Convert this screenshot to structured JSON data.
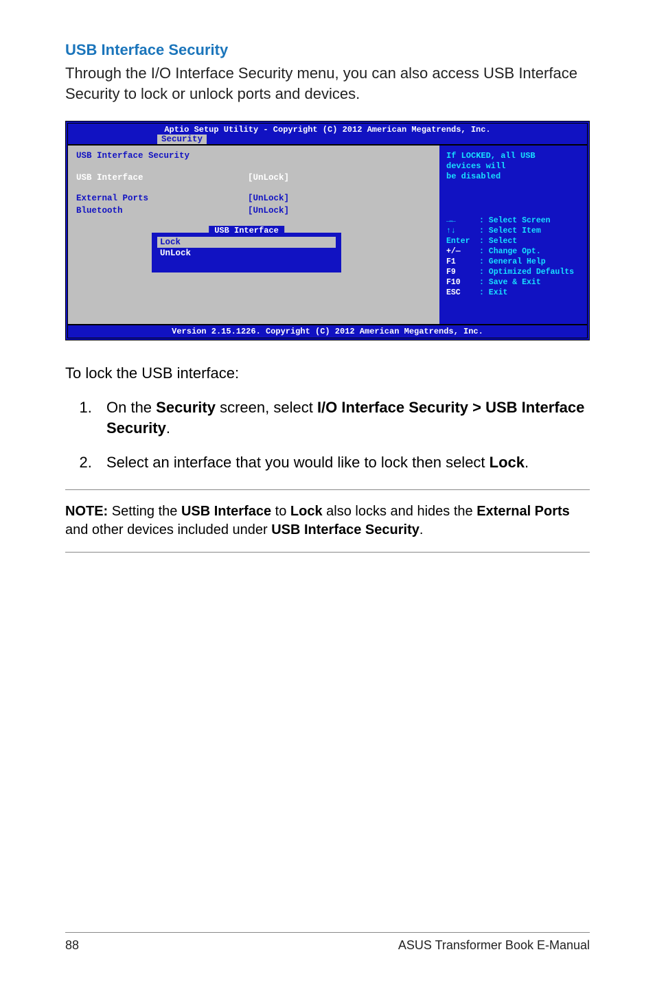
{
  "heading": "USB Interface Security",
  "body_text": "Through the I/O Interface Security menu, you can also access USB Interface Security to lock or unlock ports and devices.",
  "bios": {
    "header": "Aptio Setup Utility - Copyright (C) 2012 American Megatrends, Inc.",
    "tab": "Security",
    "left_title": "USB Interface Security",
    "rows": [
      {
        "label": "USB Interface",
        "value": "[UnLock]",
        "selected": true
      },
      {
        "label": "External Ports",
        "value": "[UnLock]",
        "selected": false
      },
      {
        "label": "Bluetooth",
        "value": "[UnLock]",
        "selected": false
      }
    ],
    "popup": {
      "title": "USB Interface",
      "items": [
        {
          "text": "Lock",
          "selected": true
        },
        {
          "text": "UnLock",
          "selected": false
        }
      ]
    },
    "right": {
      "help1": "If LOCKED, all USB",
      "help2": "devices will",
      "help3": "be disabled",
      "nav": [
        {
          "key": "→←",
          "desc": ": Select Screen"
        },
        {
          "key": "↑↓",
          "desc": ": Select Item"
        },
        {
          "key": "Enter",
          "desc": ": Select"
        },
        {
          "key": "+/—",
          "desc": ": Change Opt."
        },
        {
          "key": "F1",
          "desc": ": General Help"
        },
        {
          "key": "F9",
          "desc": ": Optimized Defaults"
        },
        {
          "key": "F10",
          "desc": ": Save & Exit"
        },
        {
          "key": "ESC",
          "desc": ": Exit"
        }
      ]
    },
    "footer": "Version 2.15.1226. Copyright (C) 2012 American Megatrends, Inc."
  },
  "instruction_lead": "To lock the USB interface:",
  "steps": {
    "s1_a": "On the ",
    "s1_b": "Security",
    "s1_c": " screen, select ",
    "s1_d": "I/O Interface Security > USB Interface Security",
    "s1_e": ".",
    "s2_a": "Select an interface that you would like to lock then select ",
    "s2_b": "Lock",
    "s2_c": "."
  },
  "note": {
    "a": "NOTE:",
    "b": " Setting the ",
    "c": "USB Interface",
    "d": " to ",
    "e": "Lock",
    "f": " also locks and hides the ",
    "g": "External Ports",
    "h": " and other devices included under ",
    "i": "USB Interface Security",
    "j": "."
  },
  "footer": {
    "page": "88",
    "title": "ASUS Transformer Book E-Manual"
  }
}
